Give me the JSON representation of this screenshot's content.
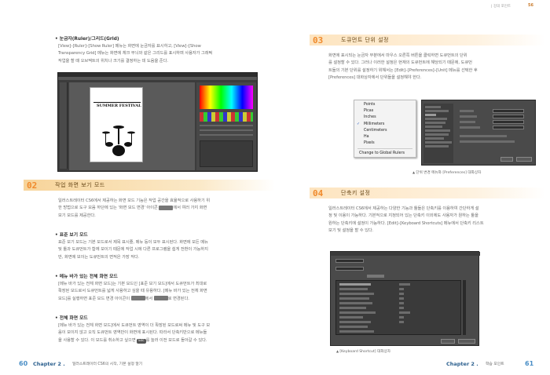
{
  "left": {
    "bullet_rulers": "눈금자(Ruler)/그리드(Grid)",
    "rulers_text": [
      "[View]–[Ruler]–[Show Ruler] 메뉴는 화면에 눈금자를 표시하고, [View]–[Show",
      "Transparency Grid] 메뉴는 화면에 체크 무늬와 같은 그리드를 표시하며 사용자가 그래픽",
      "작업을 할 때 오브젝트의 위치나 크기를 결정하는 데 도움을 준다."
    ],
    "canvas_poster_title": "SUMMER FESTIVAL",
    "section_num": "02",
    "section_title": "작업 화면 보기 모드",
    "intro_text": [
      "일러스트레이터 CS6에서 제공하는 화면 모드 기능은 작업 공간을 효율적으로 사용하기 위",
      "한 방법으로 도구 모음 하단에 있는 '화면 모드 변경' 아이콘",
      "에서 여러 가지 화면",
      "보기 모드를 제공한다."
    ],
    "bullet_standard": "표준 보기 모드",
    "standard_text": [
      "표준 보기 모드는 기본 모드로서 제목 표시줄, 메뉴 등이 모두 표시된다. 화면에 모든 메뉴",
      "및 툴과 도큐먼트가 함께 보이기 때문에 작업 시에 다른 프로그램을 쉽게 전환이 가능하지",
      "만, 화면에 보이는 도큐먼트의 면적은 가장 작다."
    ],
    "bullet_menubar": "메뉴 바가 있는 전체 화면 모드",
    "menubar_text": [
      "[메뉴 바가 있는 전체 화면 모드]는 기본 모드인 [표준 보기 모드]에서 도큐먼트가 최대로",
      "확장된 모드로서 도큐먼트를 넓게 사용하고 싶을 때 유용하다. [메뉴 바가 있는 전체 화면",
      "모드]를 실행하면 표준 모드 변경 아이콘이",
      "에서",
      "로 변경된다."
    ],
    "bullet_full": "전체 화면 모드",
    "full_text": [
      "[메뉴 바가 있는 전체 화면 모드]에서 도큐먼트 영역이 더 확장된 모드로써 메뉴 및 도구 모",
      "음이 보이지 않고 오직 도큐먼트 영역만이 화면에 표시된다. 따라서 단축키만으로 메뉴들",
      "을 사용할 수 있다. 이 모드를 취소하고 싶으면",
      "를 눌러 이전 모드로 돌아갈 수 있다."
    ],
    "esc_key": "Esc",
    "page_number": "60",
    "chapter_label": "Chapter 2 .",
    "chapter_sub": "일러스트레이터 CS6의 시작, 기본 설정 알기"
  },
  "right": {
    "header_tag": "| 강의 포인트",
    "header_num": "56",
    "section3_num": "03",
    "section3_title": "도큐먼트 단위 설정",
    "section3_text": [
      "화면에 표시되는 눈금자 부분에서 마우스 오른쪽 버튼을 클릭하면 도큐먼트의 단위",
      "를 설정할 수 있다. 그러나 이러한 설정은 현재의 도큐먼트에 해당되기 때문에, 도큐먼",
      "트들의 기본 단위를 설정하기 위해서는 [Edit]–[Preferences]–[Unit] 메뉴를 선택한 후",
      "[Preferences] 대화상자에서 단위들을 설정해야 한다."
    ],
    "unit_menu": [
      "Points",
      "Picas",
      "Inches",
      "Millimeters",
      "Centimeters",
      "Ha",
      "Pixels"
    ],
    "unit_menu_checked": "Millimeters",
    "unit_menu_extra": "Change to Global Rulers",
    "caption_units": "단위 변경 메뉴와 [Preferences] 대화상자",
    "section4_num": "04",
    "section4_title": "단축키 설정",
    "section4_text": [
      "일러스트레이터 CS6에서 제공하는 다양한 기능과 툴들은 단축키를 이용하여 간단하게 설",
      "정 및 이용이 가능하다. 기본적으로 지정되어 있는 단축키 이외에도 사용자가 원하는 툴을",
      "원하는 단축키에 설정이 가능하다. [Edit]–[Keyboard Shortcuts] 메뉴에서 단축키 리스트",
      "보기 및 설정을 할 수 있다."
    ],
    "caption_shortcuts": "[Keyboard Shortcut] 대화상자",
    "page_number": "61",
    "chapter_label": "Chapter 2 .",
    "chapter_sub": "학습 포인트"
  },
  "colors": {
    "accent_orange": "#f08a2c",
    "footer_blue": "#4a8ec6",
    "chapter_blue": "#2b5f8e"
  }
}
